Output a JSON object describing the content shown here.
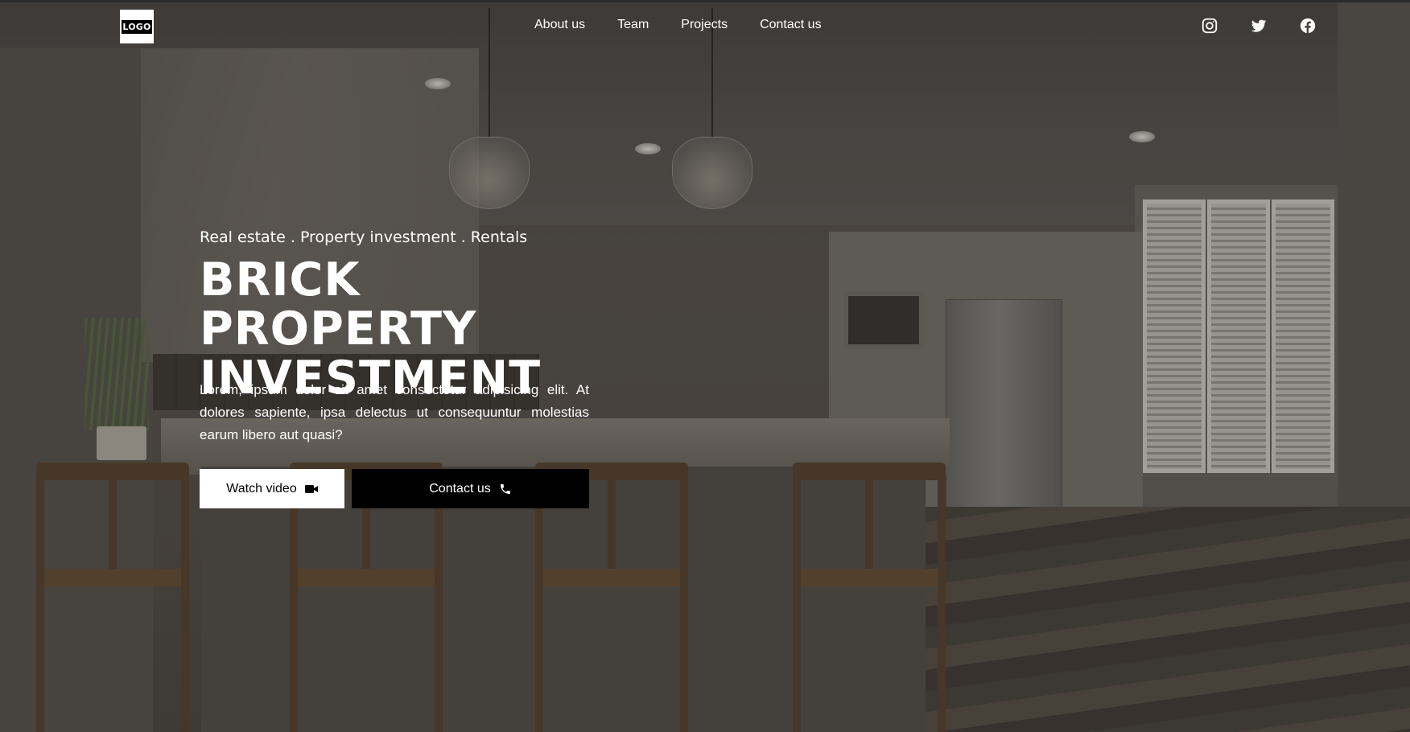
{
  "logo": {
    "text": "LOGO"
  },
  "nav": {
    "items": [
      {
        "label": "About us"
      },
      {
        "label": "Team"
      },
      {
        "label": "Projects"
      },
      {
        "label": "Contact us"
      }
    ]
  },
  "social": [
    {
      "icon": "instagram-icon"
    },
    {
      "icon": "twitter-icon"
    },
    {
      "icon": "facebook-icon"
    }
  ],
  "hero": {
    "tagline": "Real estate . Property investment . Rentals",
    "headline_line1": "BRICK PROPERTY",
    "headline_line2": "INVESTMENT",
    "description": "Lorem, ipsum dolor sit amet consectetur adipisicing elit. At dolores sapiente, ipsa delectus ut consequuntur molestias earum libero aut quasi?",
    "buttons": {
      "watch_label": "Watch video",
      "watch_icon": "video-camera-icon",
      "contact_label": "Contact us",
      "contact_icon": "phone-icon"
    }
  },
  "colors": {
    "primary_button_bg": "#ffffff",
    "secondary_button_bg": "#000000",
    "text": "#ffffff"
  }
}
